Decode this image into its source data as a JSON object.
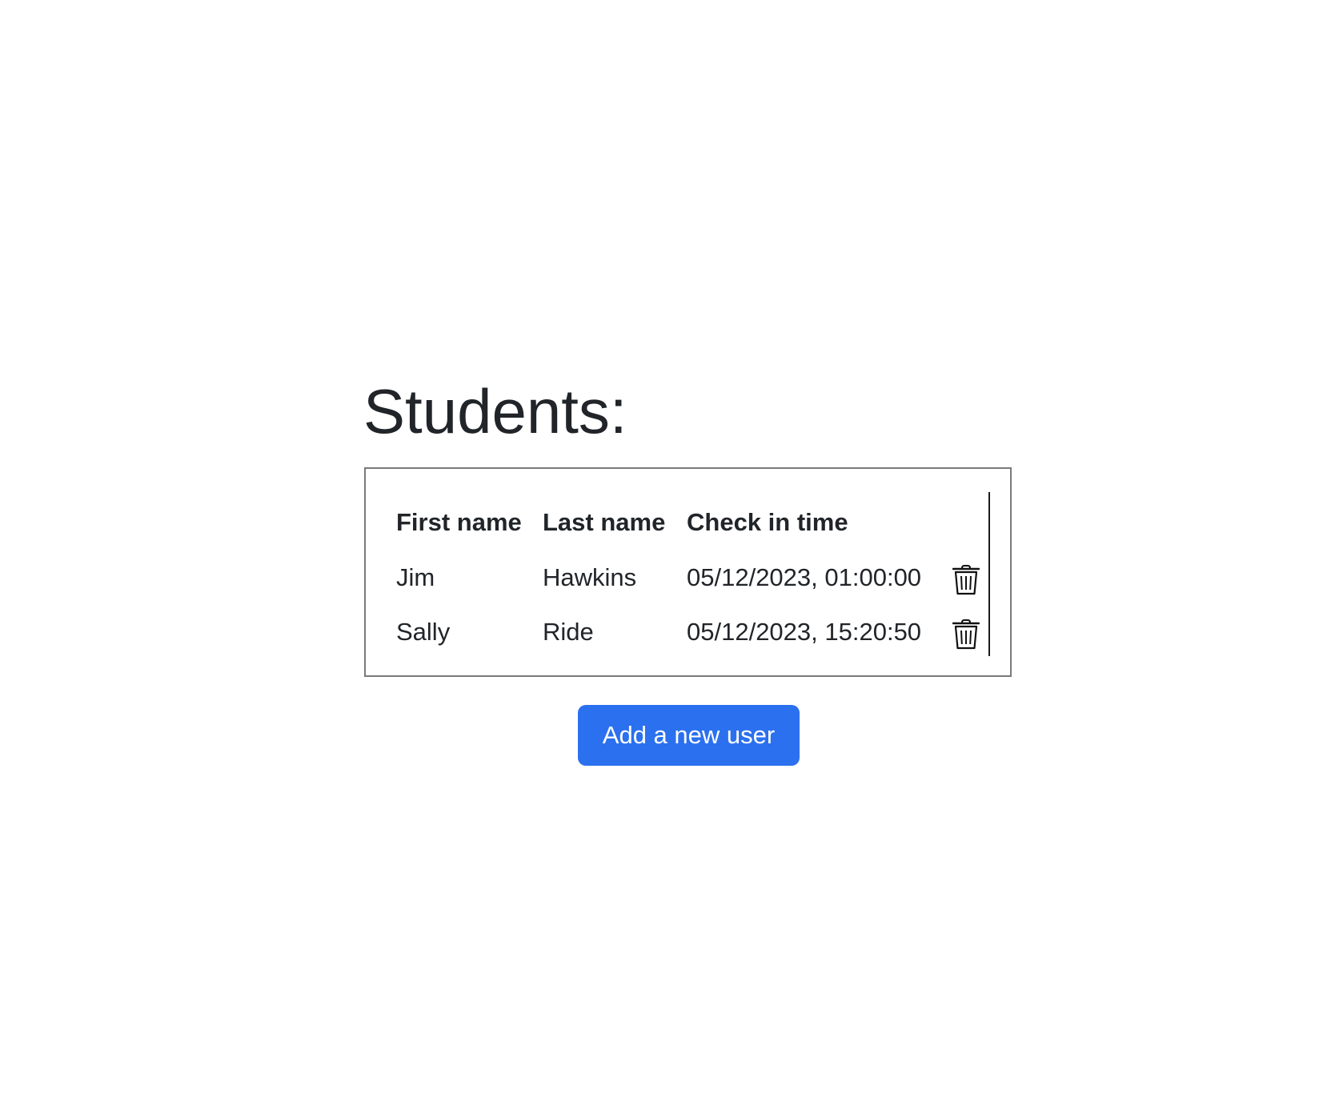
{
  "page": {
    "title": "Students:"
  },
  "table": {
    "headers": {
      "first_name": "First name",
      "last_name": "Last name",
      "check_in_time": "Check in time"
    },
    "rows": [
      {
        "first_name": "Jim",
        "last_name": "Hawkins",
        "check_in_time": "05/12/2023, 01:00:00",
        "action_icon": "trash-icon"
      },
      {
        "first_name": "Sally",
        "last_name": "Ride",
        "check_in_time": "05/12/2023, 15:20:50",
        "action_icon": "trash-icon"
      }
    ]
  },
  "actions": {
    "add_user_label": "Add a new user"
  },
  "colors": {
    "primary": "#2b70ef",
    "text": "#212529",
    "border": "#7a7a7a",
    "background": "#ffffff"
  }
}
